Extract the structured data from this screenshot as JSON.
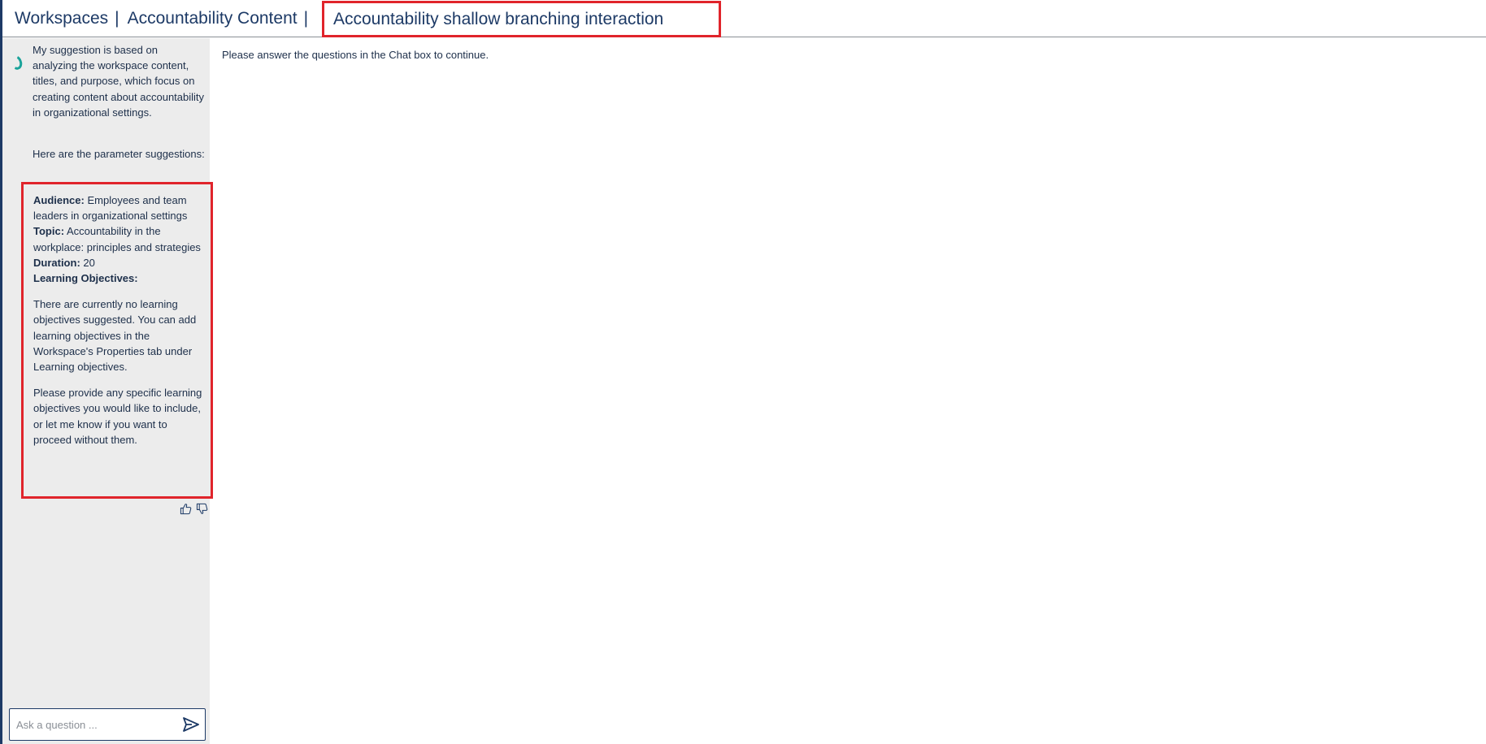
{
  "breadcrumb": {
    "items": [
      {
        "label": "Workspaces"
      },
      {
        "label": "Accountability Content"
      }
    ],
    "separator": "|",
    "current": "Accountability shallow branching interaction"
  },
  "chat": {
    "messages": [
      "My suggestion is based on analyzing the workspace content, titles, and purpose, which focus on creating content about accountability in organizational settings.",
      "Here are the parameter suggestions:"
    ],
    "suggestions": {
      "audience": {
        "label": "Audience:",
        "value": "Employees and team leaders in organizational settings"
      },
      "topic": {
        "label": "Topic:",
        "value": "Accountability in the workplace: principles and strategies"
      },
      "duration": {
        "label": "Duration:",
        "value": "20"
      },
      "learning_objectives": {
        "label": "Learning Objectives:"
      },
      "no_objectives_note": "There are currently no learning objectives suggested. You can add learning objectives in the Workspace's Properties tab under Learning objectives.",
      "request_note": "Please provide any specific learning objectives you would like to include, or let me know if you want to proceed without them."
    },
    "input": {
      "placeholder": "Ask a question ...",
      "value": ""
    }
  },
  "main": {
    "message": "Please answer the questions in the Chat box to continue."
  },
  "colors": {
    "accent_navy": "#1d3a66",
    "highlight_red": "#e0242b",
    "spinner_teal": "#1aa39a",
    "sidebar_bg": "#ececec"
  },
  "icons": {
    "spinner": "loading-spinner-icon",
    "thumbs_up": "thumbs-up-icon",
    "thumbs_down": "thumbs-down-icon",
    "send": "send-icon"
  }
}
